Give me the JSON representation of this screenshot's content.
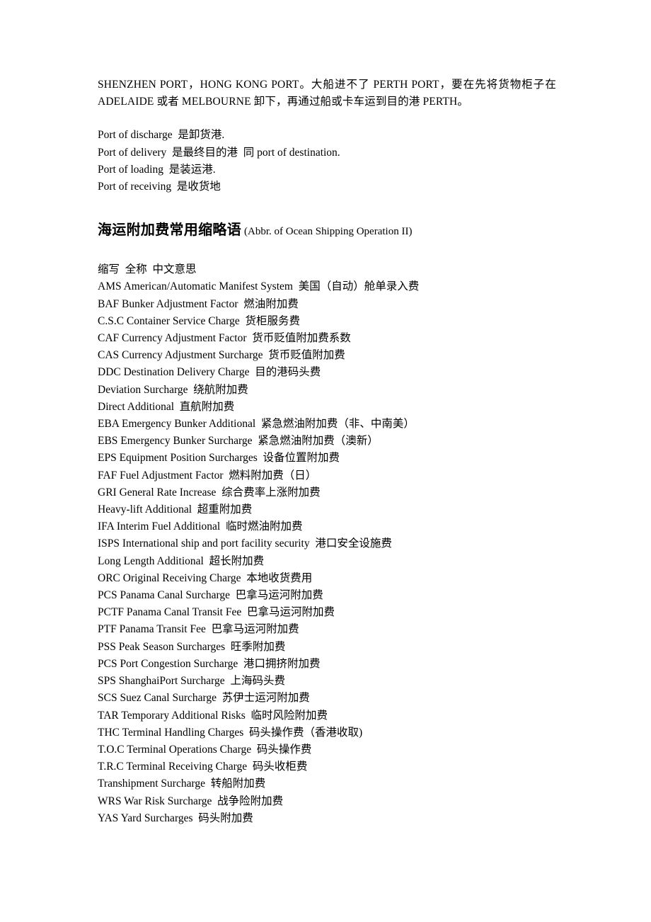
{
  "document": {
    "intro_paragraph": "SHENZHEN PORT，HONG KONG PORT。大船进不了 PERTH PORT，要在先将货物柜子在 ADELAIDE 或者 MELBOURNE 卸下，再通过船或卡车运到目的港 PERTH。",
    "port_terms": [
      "Port of discharge  是卸货港.",
      "Port of delivery  是最终目的港  同 port of destination.",
      "Port of loading  是装运港.",
      "Port of receiving  是收货地"
    ],
    "section": {
      "heading_zh": "海运附加费常用缩略语",
      "heading_en": "(Abbr. of Ocean Shipping Operation II)"
    },
    "abbr_table": {
      "header": "缩写  全称  中文意思",
      "rows": [
        "AMS American/Automatic Manifest System  美国（自动）舱单录入费",
        "BAF Bunker Adjustment Factor  燃油附加费",
        "C.S.C Container Service Charge  货柜服务费",
        "CAF Currency Adjustment Factor  货币贬值附加费系数",
        "CAS Currency Adjustment Surcharge  货币贬值附加费",
        "DDC Destination Delivery Charge  目的港码头费",
        "Deviation Surcharge  绕航附加费",
        "Direct Additional  直航附加费",
        "EBA Emergency Bunker Additional  紧急燃油附加费（非、中南美）",
        "EBS Emergency Bunker Surcharge  紧急燃油附加费（澳新）",
        "EPS Equipment Position Surcharges  设备位置附加费",
        "FAF Fuel Adjustment Factor  燃料附加费（日）",
        "GRI General Rate Increase  综合费率上涨附加费",
        "Heavy-lift Additional  超重附加费",
        "IFA Interim Fuel Additional  临时燃油附加费",
        "ISPS International ship and port facility security  港口安全设施费",
        "Long Length Additional  超长附加费",
        "ORC Original Receiving Charge  本地收货费用",
        "PCS Panama Canal Surcharge  巴拿马运河附加费",
        "PCTF Panama Canal Transit Fee  巴拿马运河附加费",
        "PTF Panama Transit Fee  巴拿马运河附加费",
        "PSS Peak Season Surcharges  旺季附加费",
        "PCS Port Congestion Surcharge  港口拥挤附加费",
        "SPS ShanghaiPort Surcharge  上海码头费",
        "SCS Suez Canal Surcharge  苏伊士运河附加费",
        "TAR Temporary Additional Risks  临时风险附加费",
        "THC Terminal Handling Charges  码头操作费（香港收取)",
        "T.O.C Terminal Operations Charge  码头操作费",
        "T.R.C Terminal Receiving Charge  码头收柜费",
        "Transhipment Surcharge  转船附加费",
        "WRS War Risk Surcharge  战争险附加费",
        "YAS Yard Surcharges  码头附加费"
      ]
    }
  }
}
